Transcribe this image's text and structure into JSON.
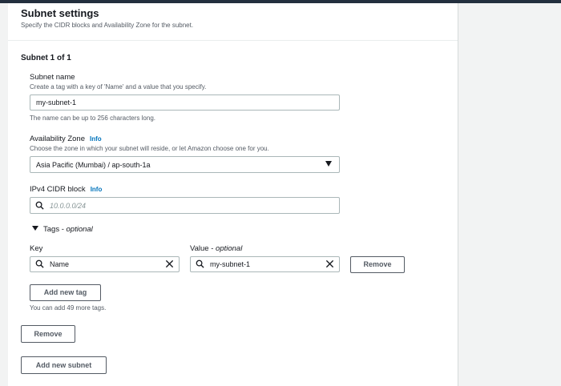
{
  "header": {
    "title": "Subnet settings",
    "subtitle": "Specify the CIDR blocks and Availability Zone for the subnet."
  },
  "subnet": {
    "section_title": "Subnet 1 of 1",
    "name": {
      "label": "Subnet name",
      "description": "Create a tag with a key of 'Name' and a value that you specify.",
      "value": "my-subnet-1",
      "constraint": "The name can be up to 256 characters long."
    },
    "az": {
      "label": "Availability Zone",
      "info": "Info",
      "description": "Choose the zone in which your subnet will reside, or let Amazon choose one for you.",
      "value": "Asia Pacific (Mumbai) / ap-south-1a"
    },
    "cidr": {
      "label": "IPv4 CIDR block",
      "info": "Info",
      "placeholder": "10.0.0.0/24"
    },
    "tags": {
      "toggle_label": "Tags - ",
      "toggle_optional": "optional",
      "key_header": "Key",
      "value_header": "Value - ",
      "value_optional": "optional",
      "rows": [
        {
          "key": "Name",
          "value": "my-subnet-1",
          "remove_label": "Remove"
        }
      ],
      "add_label": "Add new tag",
      "remaining_text": "You can add 49 more tags."
    },
    "remove_subnet_label": "Remove"
  },
  "add_subnet_label": "Add new subnet",
  "colors": {
    "accent_link": "#0073bb",
    "topbar": "#232f3e",
    "background": "#f2f3f3"
  }
}
